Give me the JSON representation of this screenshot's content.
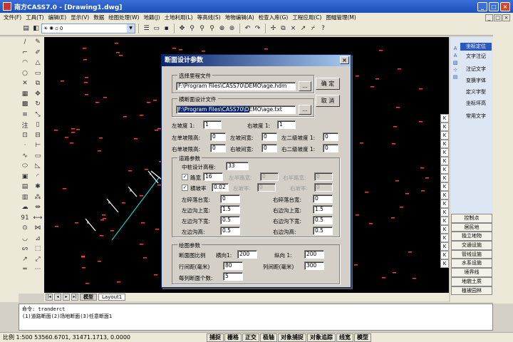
{
  "window": {
    "title": "南方CASS7.0 - [Drawing1.dwg]"
  },
  "menu": [
    "文件(F)",
    "工具(T)",
    "编辑(E)",
    "显示(V)",
    "数据",
    "绘图处理(W)",
    "地籍(J)",
    "土地利用(L)",
    "等高线(S)",
    "地物编辑(A)",
    "检查入库(G)",
    "工程应用(C)",
    "图幅管理(M)"
  ],
  "toolbar": {
    "layer_value": "0"
  },
  "dialog": {
    "title": "断面设计参数",
    "close_glyph": "×",
    "mileage_group": "选择里程文件",
    "mileage_path": "F:\\Program Files\\CASS70\\DEMO\\age.hdm",
    "browse1": "...",
    "cross_group": "横断面设计文件",
    "cross_path_sel": "F:\\Program Files\\CASS70\\D",
    "cross_path_rest": "EMO\\age.txt",
    "browse2": "...",
    "ok": "确 定",
    "cancel": "取 消",
    "left_slope_label": "左坡度 1:",
    "left_slope": "1",
    "right_slope_label": "右坡度 1:",
    "right_slope": "1",
    "lsh_label": "左单坡限高:",
    "lsh": "0",
    "lsw_label": "左坡间宽:",
    "lsw": "0",
    "l2s_label": "左二级坡度 1:",
    "l2s": "0",
    "rsh_label": "右单坡限高:",
    "rsh": "0",
    "rsw_label": "右坡间宽:",
    "rsw": "0",
    "r2s_label": "右二级坡度 1:",
    "r2s": "0",
    "road_group": "道路参数",
    "center_label": "中桩设计高程:",
    "center": "33",
    "road_width_label": "路宽",
    "road_width": "16",
    "left_road_label": "左半路宽:",
    "left_road": "0",
    "right_road_label": "右半路宽:",
    "right_road": "0",
    "cross_slope_label": "横坡率",
    "cross_slope": "0.02",
    "left_pct_label": "左坡率:",
    "left_pct": "0",
    "right_pct_label": "右坡率:",
    "right_pct": "0",
    "l_berm_label": "左碎落台宽:",
    "l_berm": "0",
    "r_berm_label": "右碎落台宽:",
    "r_berm": "0",
    "l_ditch_top_label": "左边沟上宽:",
    "l_ditch_top": "1.5",
    "r_ditch_top_label": "右边沟上宽:",
    "r_ditch_top": "1.5",
    "l_ditch_bot_label": "左边沟下宽:",
    "l_ditch_bot": "0.5",
    "r_ditch_bot_label": "右边沟下宽:",
    "r_ditch_bot": "0.5",
    "l_ditch_h_label": "左边沟高:",
    "l_ditch_h": "0.5",
    "r_ditch_h_label": "右边沟高:",
    "r_ditch_h": "0.5",
    "plot_group": "绘图参数",
    "scale_label": "断面图比例",
    "h_scale_label": "横向1:",
    "h_scale": "200",
    "v_scale_label": "纵向 1:",
    "v_scale": "200",
    "row_gap_label": "行间距(毫米)",
    "row_gap": "80",
    "col_gap_label": "列间距(毫米)",
    "col_gap": "300",
    "per_row_label": "每列断面个数:",
    "per_row": "5",
    "check_mark": "✓"
  },
  "right_panel": {
    "top": [
      "坐标定位",
      "文字注记",
      "注记文字",
      "变换字体",
      "定义字型",
      "坐标坪高",
      "常用文字"
    ],
    "list": [
      "控制点",
      "居民地",
      "独立地物",
      "交通设施",
      "管线设施",
      "水系设施",
      "境界线",
      "地貌土质",
      "植被园林"
    ]
  },
  "klist": [
    "K",
    "K",
    "K",
    "K",
    "K",
    "K",
    "K",
    "K",
    "K",
    "K",
    "K",
    "K",
    "K",
    "K",
    "K",
    "K",
    "K",
    "K"
  ],
  "tabs": {
    "model": "模型",
    "layout": "Layout1"
  },
  "command": {
    "line1": "命令: tranderct",
    "line2": "(1)道路断面(2)场地断面(3)任意断面1"
  },
  "status": {
    "coords": "比例 1:500 53560.6701, 31471.1713, 0.0000",
    "buttons": [
      "捕捉",
      "栅格",
      "正交",
      "极轴",
      "对象捕捉",
      "对象追踪",
      "线宽",
      "模型"
    ]
  }
}
